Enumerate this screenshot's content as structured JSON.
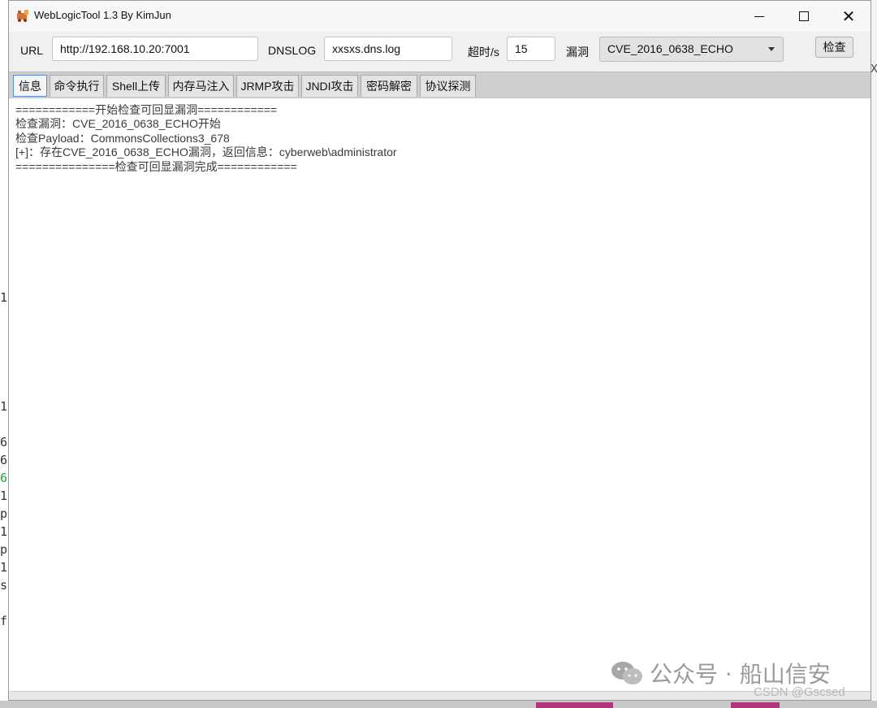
{
  "window": {
    "title": "WebLogicTool 1.3 By KimJun"
  },
  "toolbar": {
    "url_label": "URL",
    "url_value": "http://192.168.10.20:7001",
    "dnslog_label": "DNSLOG",
    "dnslog_value": "xxsxs.dns.log",
    "timeout_label": "超时/s",
    "timeout_value": "15",
    "vuln_label": "漏洞",
    "vuln_selected": "CVE_2016_0638_ECHO",
    "check_button": "检查"
  },
  "tabs": [
    {
      "label": "信息",
      "active": true
    },
    {
      "label": "命令执行"
    },
    {
      "label": "Shell上传"
    },
    {
      "label": "内存马注入"
    },
    {
      "label": "JRMP攻击"
    },
    {
      "label": "JNDI攻击"
    },
    {
      "label": "密码解密"
    },
    {
      "label": "协议探测"
    }
  ],
  "log": [
    "============开始检查可回显漏洞============",
    "检查漏洞：CVE_2016_0638_ECHO开始",
    "检查Payload：CommonsCollections3_678",
    "[+]：存在CVE_2016_0638_ECHO漏洞，返回信息：cyberweb\\administrator",
    "===============检查可回显漏洞完成============"
  ],
  "background_chars": [
    "1",
    "1",
    "6",
    "6",
    "6",
    "1",
    "p",
    "1",
    "p",
    "1",
    "s",
    "f"
  ],
  "background_right_chars": [
    "X"
  ],
  "watermark": {
    "text": "公众号 · 船山信安",
    "sub": "CSDN @Gscsed"
  },
  "colors": {
    "active_tab_border": "#5a8fd8",
    "log_text": "#3a3a3a"
  }
}
